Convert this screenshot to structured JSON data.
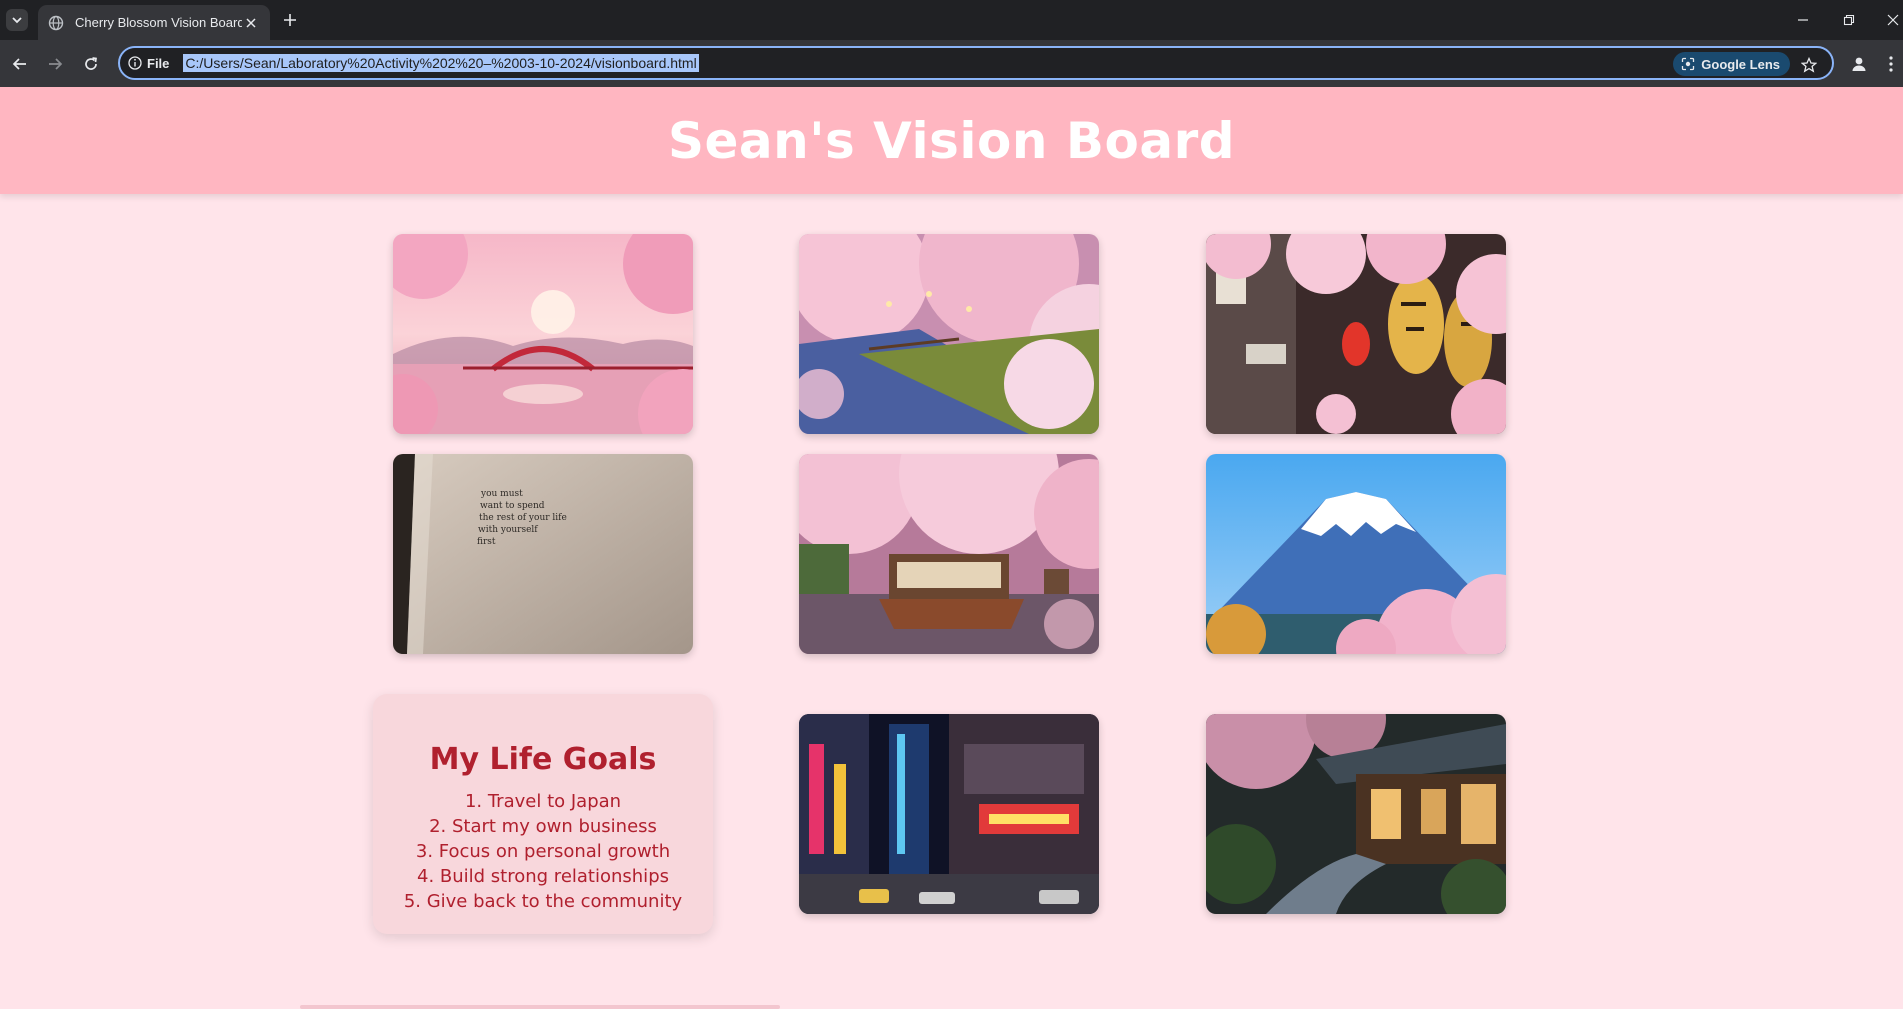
{
  "browser": {
    "tab": {
      "title": "Cherry Blossom Vision Board",
      "icon": "globe-icon"
    },
    "address": {
      "chip_label": "File",
      "url": "C:/Users/Sean/Laboratory%20Activity%202%20–%2003-10-2024/visionboard.html"
    },
    "lens_label": "Google Lens"
  },
  "page": {
    "title": "Sean's Vision Board",
    "photos": [
      {
        "subject": "Cherry blossoms over a red arched bridge at sunset"
      },
      {
        "subject": "Cherry blossom trees along a canal at dusk"
      },
      {
        "subject": "Japanese street with hanging lanterns and cherry blossoms"
      },
      {
        "subject": "Book page with a short quote"
      },
      {
        "subject": "Wooden boat on a river under cherry blossoms"
      },
      {
        "subject": "Mount Fuji with pink cherry blossoms"
      },
      {
        "subject": "Neon-lit Tokyo street at night"
      },
      {
        "subject": "Traditional Japanese house with stone garden path"
      }
    ],
    "book_quote": [
      "you must",
      "want to spend",
      "the rest of your life",
      "with yourself",
      "first"
    ],
    "goals": {
      "title": "My Life Goals",
      "items": [
        "1. Travel to Japan",
        "2. Start my own business",
        "3. Focus on personal growth",
        "4. Build strong relationships",
        "5. Give back to the community"
      ]
    }
  },
  "colors": {
    "header_bg": "#ffb6c1",
    "page_bg": "#ffe4ea",
    "goals_card_bg": "#f8d7dc",
    "goals_text": "#b0202e"
  }
}
